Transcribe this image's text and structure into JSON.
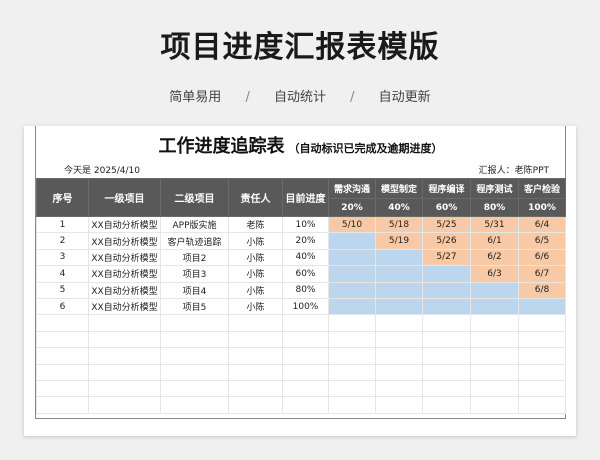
{
  "banner": {
    "title": "项目进度汇报表模版",
    "tags": [
      "简单易用",
      "自动统计",
      "自动更新"
    ]
  },
  "sheet": {
    "title": "工作进度追踪表",
    "subtitle": "（自动标识已完成及逾期进度）",
    "today_label": "今天是 2025/4/10",
    "reporter_label": "汇报人：老陈PPT",
    "headers": [
      "序号",
      "一级项目",
      "二级项目",
      "责任人",
      "目前进度"
    ],
    "stages": [
      {
        "name": "需求沟通",
        "pct": "20%"
      },
      {
        "name": "模型制定",
        "pct": "40%"
      },
      {
        "name": "程序编译",
        "pct": "60%"
      },
      {
        "name": "程序测试",
        "pct": "80%"
      },
      {
        "name": "客户检验",
        "pct": "100%"
      }
    ],
    "rows": [
      {
        "no": "1",
        "l1": "XX自动分析模型",
        "l2": "APP版实施",
        "owner": "老陈",
        "progress": "10%",
        "dates": [
          "5/10",
          "5/18",
          "5/25",
          "5/31",
          "6/4"
        ]
      },
      {
        "no": "2",
        "l1": "XX自动分析模型",
        "l2": "客户轨迹追踪",
        "owner": "小陈",
        "progress": "20%",
        "dates": [
          "",
          "5/19",
          "5/26",
          "6/1",
          "6/5"
        ]
      },
      {
        "no": "3",
        "l1": "XX自动分析模型",
        "l2": "项目2",
        "owner": "小陈",
        "progress": "40%",
        "dates": [
          "",
          "",
          "5/27",
          "6/2",
          "6/6"
        ]
      },
      {
        "no": "4",
        "l1": "XX自动分析模型",
        "l2": "项目3",
        "owner": "小陈",
        "progress": "60%",
        "dates": [
          "",
          "",
          "",
          "6/3",
          "6/7"
        ]
      },
      {
        "no": "5",
        "l1": "XX自动分析模型",
        "l2": "项目4",
        "owner": "小陈",
        "progress": "80%",
        "dates": [
          "",
          "",
          "",
          "",
          "6/8"
        ]
      },
      {
        "no": "6",
        "l1": "XX自动分析模型",
        "l2": "项目5",
        "owner": "小陈",
        "progress": "100%",
        "dates": [
          "",
          "",
          "",
          "",
          ""
        ]
      }
    ],
    "empty_row_count": 6,
    "colors": {
      "done": "#bcd6ee",
      "pending": "#f8c9a6",
      "header": "#595959"
    }
  }
}
